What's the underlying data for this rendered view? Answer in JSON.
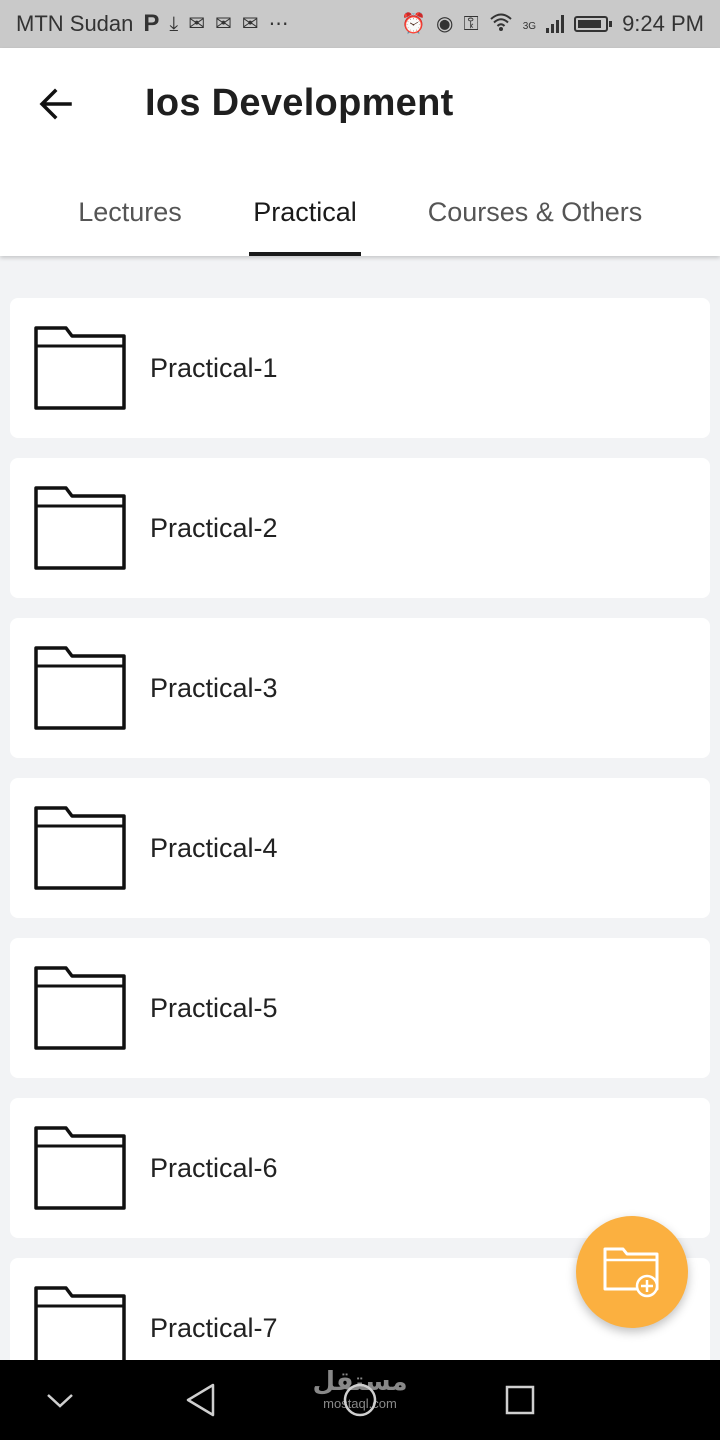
{
  "status_bar": {
    "carrier": "MTN Sudan",
    "time": "9:24 PM",
    "network": "3G",
    "battery_level": 0.9
  },
  "app_bar": {
    "title": "Ios Development"
  },
  "tabs": [
    {
      "label": "Lectures",
      "active": false
    },
    {
      "label": "Practical",
      "active": true
    },
    {
      "label": "Courses & Others",
      "active": false
    }
  ],
  "list": {
    "items": [
      {
        "label": "Practical-1",
        "icon": "folder-icon"
      },
      {
        "label": "Practical-2",
        "icon": "folder-icon"
      },
      {
        "label": "Practical-3",
        "icon": "folder-icon"
      },
      {
        "label": "Practical-4",
        "icon": "folder-icon"
      },
      {
        "label": "Practical-5",
        "icon": "folder-icon"
      },
      {
        "label": "Practical-6",
        "icon": "folder-icon"
      },
      {
        "label": "Practical-7",
        "icon": "folder-icon"
      }
    ]
  },
  "fab": {
    "icon": "add-folder-icon",
    "color": "#fbb040"
  },
  "watermark": {
    "text": "مستقل",
    "sub": "mostaql.com"
  },
  "colors": {
    "accent": "#fbb040",
    "tab_indicator": "#1a1a1a",
    "background": "#f2f3f5"
  }
}
